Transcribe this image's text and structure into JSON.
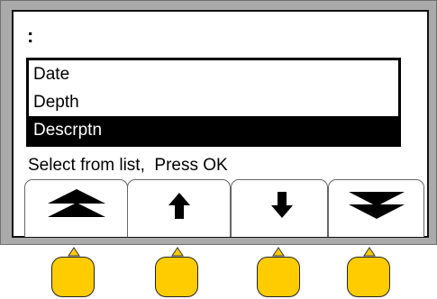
{
  "display": {
    "header": ":",
    "list_items": [
      "Date",
      "Depth",
      "Descrptn"
    ],
    "selected_index": 2,
    "prompt": "Select from list,  Press OK"
  },
  "softkeys": [
    {
      "icon": "double-chevron-up-icon"
    },
    {
      "icon": "arrow-up-icon"
    },
    {
      "icon": "arrow-down-icon"
    },
    {
      "icon": "double-chevron-down-icon"
    }
  ],
  "colors": {
    "bezel": "#aaaaaa",
    "selection": "#000000",
    "button": "#ffcc00"
  }
}
